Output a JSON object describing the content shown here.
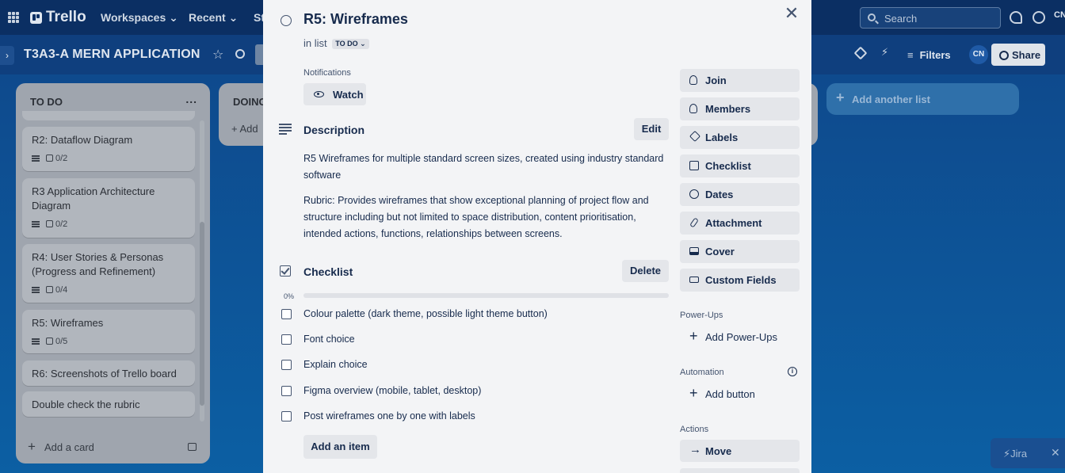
{
  "topbar": {
    "logo": "Trello",
    "nav": [
      "Workspaces",
      "Recent",
      "St"
    ],
    "search_placeholder": "Search",
    "avatar": "CN"
  },
  "boardbar": {
    "title": "T3A3-A MERN APPLICATION",
    "filters": "Filters",
    "member_initials": "CN",
    "share": "Share"
  },
  "lists": {
    "todo": {
      "title": "TO DO",
      "more": "...",
      "cards": [
        {
          "title": "R2: Dataflow Diagram",
          "checklist": "0/2"
        },
        {
          "title": "R3 Application Architecture Diagram",
          "checklist": "0/2"
        },
        {
          "title": "R4: User Stories & Personas (Progress and Refinement)",
          "checklist": "0/4"
        },
        {
          "title": "R5: Wireframes",
          "checklist": "0/5"
        },
        {
          "title": "R6: Screenshots of Trello board"
        },
        {
          "title": "Double check the rubric"
        }
      ],
      "add_card": "Add a card"
    },
    "doing": {
      "title": "DOING",
      "add_card": "+ Add"
    },
    "add_another": "Add another list"
  },
  "jira": {
    "label": "Jira",
    "close": "✕"
  },
  "modal": {
    "title": "R5: Wireframes",
    "close": "✕",
    "in_list_prefix": "in list",
    "list_name": "TO DO",
    "notifications_label": "Notifications",
    "watch": "Watch",
    "description_title": "Description",
    "edit": "Edit",
    "description": [
      "R5 Wireframes for multiple standard screen sizes, created using industry standard software",
      "Rubric: Provides wireframes that show exceptional planning of project flow and structure including but not limited to space distribution, content prioritisation, intended actions, functions, relationships between screens."
    ],
    "checklist_title": "Checklist",
    "delete": "Delete",
    "progress_label": "0%",
    "progress_value": 0,
    "checklist_items": [
      "Colour palette (dark theme, possible light theme button)",
      "Font choice",
      "Explain choice",
      "Figma overview (mobile, tablet, desktop)",
      "Post wireframes one by one with labels"
    ],
    "add_item": "Add an item",
    "side": {
      "buttons": [
        "Join",
        "Members",
        "Labels",
        "Checklist",
        "Dates",
        "Attachment",
        "Cover",
        "Custom Fields"
      ],
      "powerups_label": "Power-Ups",
      "add_powerups": "Add Power-Ups",
      "automation_label": "Automation",
      "add_button": "Add button",
      "actions_label": "Actions",
      "move": "Move"
    }
  }
}
